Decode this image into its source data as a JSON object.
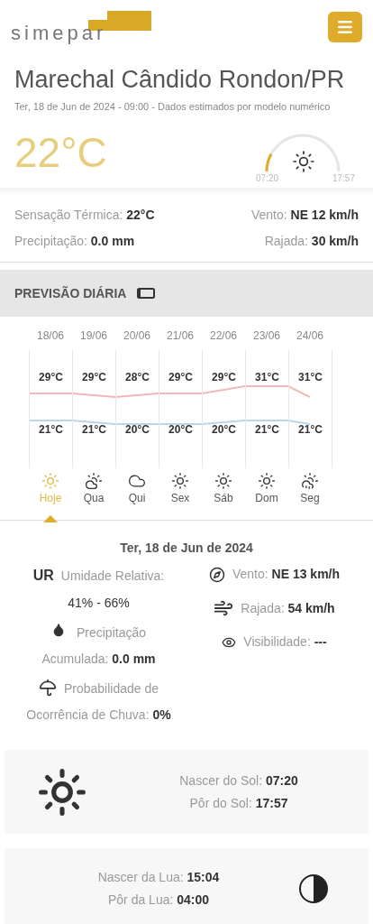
{
  "header": {
    "logo_text": "simepar"
  },
  "location": {
    "title": "Marechal Cândido Rondon/PR",
    "subtitle": "Ter, 18 de Jun de 2024 - 09:00 - Dados estimados por modelo numérico",
    "temperature": "22°C",
    "sun_arc": {
      "sunrise": "07:20",
      "sunset": "17:57"
    }
  },
  "current": [
    {
      "label": "Sensação Térmica:",
      "value": "22°C"
    },
    {
      "label": "Vento:",
      "value": "NE 12 km/h"
    },
    {
      "label": "Precipitação:",
      "value": "0.0 mm"
    },
    {
      "label": "Rajada:",
      "value": "30 km/h"
    }
  ],
  "daily": {
    "title": "PREVISÃO DIÁRIA",
    "days": [
      {
        "date": "18/06",
        "max": "29°C",
        "min": "21°C",
        "weekday": "Hoje",
        "kind": "sunny",
        "selected": true
      },
      {
        "date": "19/06",
        "max": "29°C",
        "min": "21°C",
        "weekday": "Qua",
        "kind": "partly_cloudy",
        "selected": false
      },
      {
        "date": "20/06",
        "max": "28°C",
        "min": "20°C",
        "weekday": "Qui",
        "kind": "cloudy",
        "selected": false
      },
      {
        "date": "21/06",
        "max": "29°C",
        "min": "20°C",
        "weekday": "Sex",
        "kind": "sunny",
        "selected": false
      },
      {
        "date": "22/06",
        "max": "29°C",
        "min": "20°C",
        "weekday": "Sáb",
        "kind": "sunny",
        "selected": false
      },
      {
        "date": "23/06",
        "max": "31°C",
        "min": "21°C",
        "weekday": "Dom",
        "kind": "sunny",
        "selected": false
      },
      {
        "date": "24/06",
        "max": "31°C",
        "min": "21°C",
        "weekday": "Seg",
        "kind": "rain",
        "selected": false
      }
    ]
  },
  "details": {
    "date": "Ter, 18 de Jun de 2024",
    "humidity": {
      "badge": "UR",
      "label": "Umidade Relativa:",
      "value": "41% - 66%"
    },
    "precipitation": {
      "title": "Precipitação",
      "label": "Acumulada:",
      "value": "0.0 mm"
    },
    "rain_probability": {
      "title": "Probabilidade de",
      "label": "Ocorrência de Chuva:",
      "value": "0%"
    },
    "wind": {
      "label": "Vento:",
      "value": "NE 13 km/h"
    },
    "gust": {
      "label": "Rajada:",
      "value": "54 km/h"
    },
    "visibility": {
      "label": "Visibilidade:",
      "value": "---"
    }
  },
  "sun": {
    "rise_label": "Nascer do Sol:",
    "rise": "07:20",
    "set_label": "Pôr do Sol:",
    "set": "17:57"
  },
  "moon": {
    "rise_label": "Nascer da Lua:",
    "rise": "15:04",
    "set_label": "Pôr da Lua:",
    "set": "04:00"
  }
}
